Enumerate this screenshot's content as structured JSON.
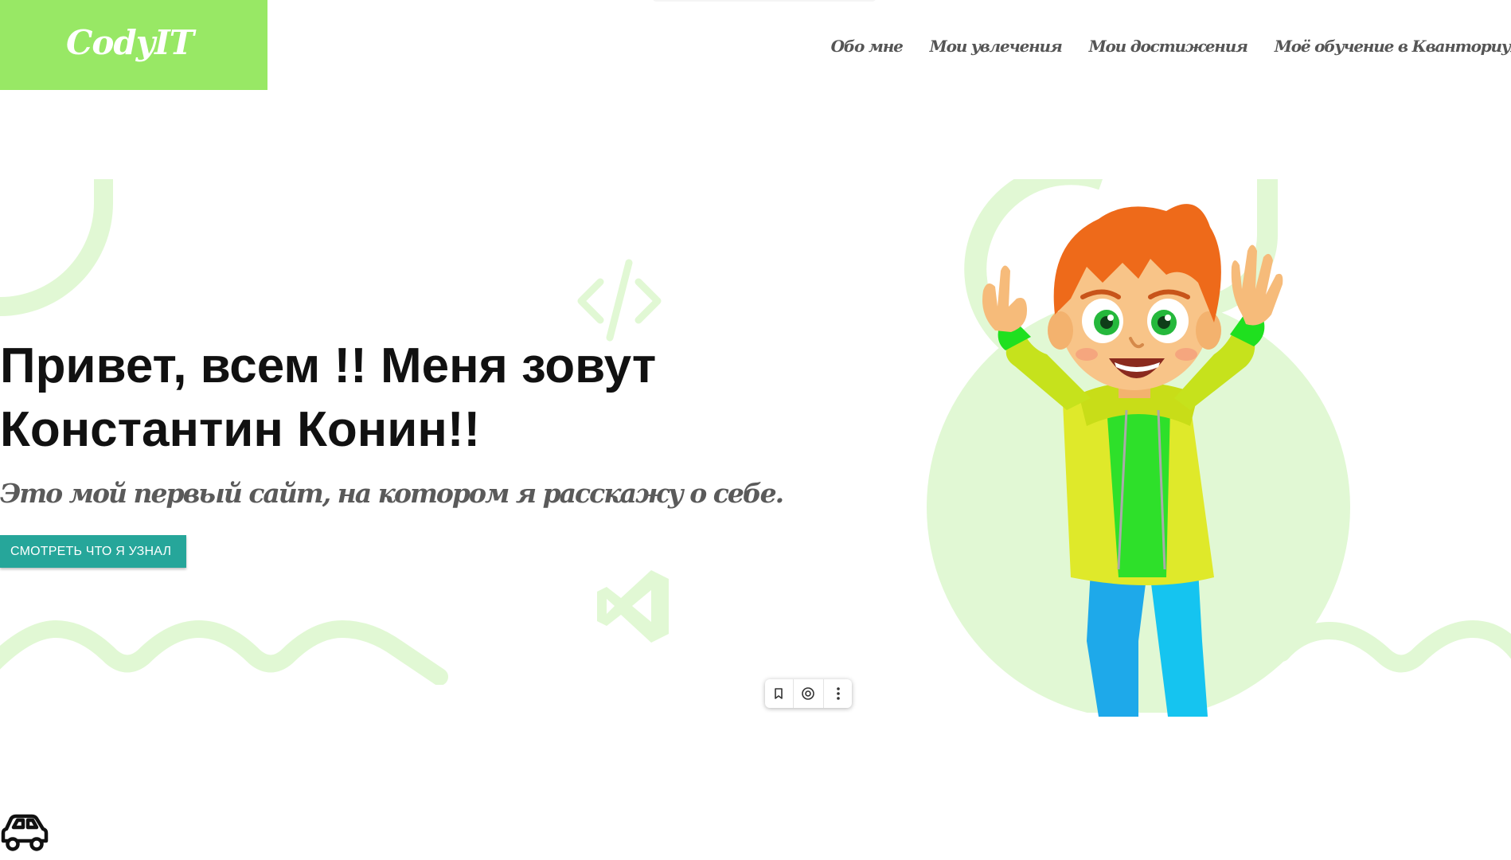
{
  "brand": {
    "logo_text": "CodyIT",
    "accent": "#98e865",
    "deco_color": "#e1f8d4",
    "button_color": "#26a69a"
  },
  "nav": {
    "items": [
      "Обо мне",
      "Мои увлечения",
      "Мои достижения",
      "Моё обучение в Кванториуме"
    ]
  },
  "hero": {
    "title_line1": "Привет, всем !! Меня зовут",
    "title_line2": "Константин Конин!!",
    "subtitle": "Это мой первый сайт, на котором я расскажу о себе.",
    "cta_label": "СМОТРЕТЬ ЧТО Я УЗНАЛ"
  },
  "icons": [
    "code-icon",
    "vscode-icon",
    "car-icon",
    "bookmark-icon",
    "screenshot-icon",
    "more-vert-icon"
  ]
}
